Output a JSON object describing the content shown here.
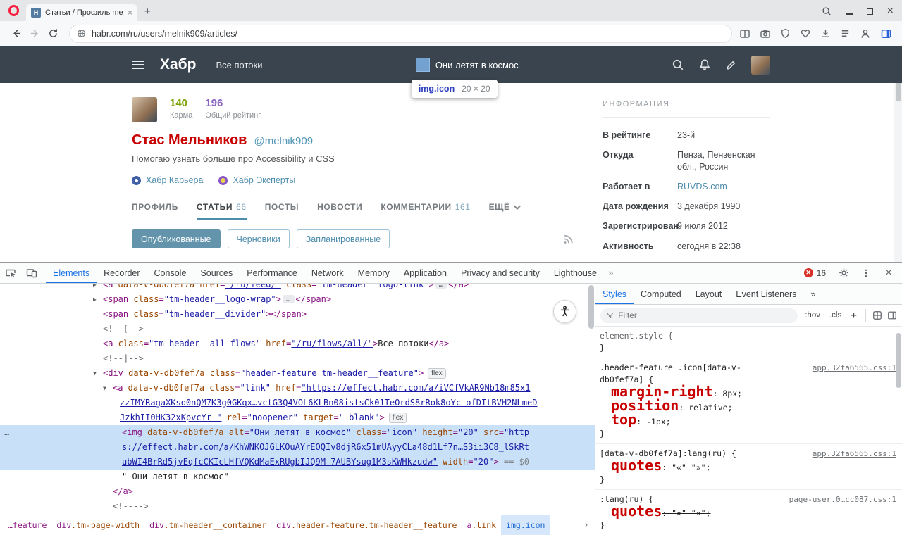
{
  "browser": {
    "tab_title": "Статьи / Профиль melnik...",
    "favicon_letter": "H",
    "tab_close_glyph": "×",
    "new_tab_glyph": "+",
    "window_close_glyph": "×",
    "url": "habr.com/ru/users/melnik909/articles/"
  },
  "site_header": {
    "logo": "Хабр",
    "all_flows": "Все потоки",
    "feature_text": "Они летят в космос",
    "tooltip": {
      "selector": "img.icon",
      "dims": "20 × 20"
    }
  },
  "profile": {
    "karma_value": "140",
    "karma_label": "Карма",
    "rating_value": "196",
    "rating_label": "Общий рейтинг",
    "name": "Стас Мельников",
    "username": "@melnik909",
    "bio": "Помогаю узнать больше про Accessibility и CSS",
    "badges": [
      {
        "label": "Хабр Карьера"
      },
      {
        "label": "Хабр Эксперты"
      }
    ],
    "tabs": [
      {
        "label": "ПРОФИЛЬ"
      },
      {
        "label": "СТАТЬИ",
        "count": "66",
        "active": true
      },
      {
        "label": "ПОСТЫ"
      },
      {
        "label": "НОВОСТИ"
      },
      {
        "label": "КОММЕНТАРИИ",
        "count": "161"
      },
      {
        "label": "ЕЩЁ",
        "chevron": true
      }
    ],
    "filters": [
      {
        "label": "Опубликованные",
        "active": true
      },
      {
        "label": "Черновики"
      },
      {
        "label": "Запланированные"
      }
    ]
  },
  "sidebar_info": {
    "title": "ИНФОРМАЦИЯ",
    "rows": [
      {
        "label": "В рейтинге",
        "value": "23-й"
      },
      {
        "label": "Откуда",
        "value": "Пенза, Пензенская обл., Россия"
      },
      {
        "label": "Работает в",
        "value": "RUVDS.com",
        "link": true
      },
      {
        "label": "Дата рождения",
        "value": "3 декабря 1990"
      },
      {
        "label": "Зарегистрирован",
        "value": "9 июля 2012"
      },
      {
        "label": "Активность",
        "value": "сегодня в 22:38"
      }
    ]
  },
  "devtools": {
    "tabs": [
      "Elements",
      "Recorder",
      "Console",
      "Sources",
      "Performance",
      "Network",
      "Memory",
      "Application",
      "Privacy and security",
      "Lighthouse"
    ],
    "active_tab": "Elements",
    "more_tabs_glyph": "»",
    "error_count": "16",
    "tree": {
      "lines": [
        {
          "pad": 146,
          "arrow": "r",
          "clip": true,
          "tokens": [
            [
              "tag",
              "<a"
            ],
            [
              "attr",
              " data-v-db0fef7a"
            ],
            [
              "attr",
              " href"
            ],
            [
              "p",
              "="
            ],
            [
              "lnk",
              "\"/ru/feed/\""
            ],
            [
              "attr",
              " class"
            ],
            [
              "p",
              "="
            ],
            [
              "val",
              "\"tm-header__logo-link\""
            ],
            [
              "tag",
              ">"
            ],
            [
              "ell",
              "…"
            ],
            [
              "tag",
              "</a>"
            ]
          ]
        },
        {
          "pad": 146,
          "arrow": "r",
          "tokens": [
            [
              "tag",
              "<span"
            ],
            [
              "attr",
              " class"
            ],
            [
              "p",
              "="
            ],
            [
              "val",
              "\"tm-header__logo-wrap\""
            ],
            [
              "tag",
              ">"
            ],
            [
              "ell",
              "…"
            ],
            [
              "tag",
              "</span>"
            ]
          ]
        },
        {
          "pad": 146,
          "tokens": [
            [
              "tag",
              "<span"
            ],
            [
              "attr",
              " class"
            ],
            [
              "p",
              "="
            ],
            [
              "val",
              "\"tm-header__divider\""
            ],
            [
              "tag",
              "></span>"
            ]
          ]
        },
        {
          "pad": 146,
          "tokens": [
            [
              "com",
              "<!--[-->"
            ]
          ]
        },
        {
          "pad": 146,
          "tokens": [
            [
              "tag",
              "<a"
            ],
            [
              "attr",
              " class"
            ],
            [
              "p",
              "="
            ],
            [
              "val",
              "\"tm-header__all-flows\""
            ],
            [
              "attr",
              " href"
            ],
            [
              "p",
              "="
            ],
            [
              "lnk",
              "\"/ru/flows/all/\""
            ],
            [
              "tag",
              ">"
            ],
            [
              "txt",
              "Все потоки"
            ],
            [
              "tag",
              "</a>"
            ]
          ]
        },
        {
          "pad": 146,
          "tokens": [
            [
              "com",
              "<!--]-->"
            ]
          ]
        },
        {
          "pad": 146,
          "arrow": "d",
          "tokens": [
            [
              "tag",
              "<div"
            ],
            [
              "attr",
              " data-v-db0fef7a"
            ],
            [
              "attr",
              " class"
            ],
            [
              "p",
              "="
            ],
            [
              "val",
              "\"header-feature tm-header__feature\""
            ],
            [
              "tag",
              ">"
            ],
            [
              "bdg",
              "flex"
            ]
          ]
        },
        {
          "pad": 160,
          "arrow": "d",
          "tokens": [
            [
              "tag",
              "<a"
            ],
            [
              "attr",
              " data-v-db0fef7a"
            ],
            [
              "attr",
              " class"
            ],
            [
              "p",
              "="
            ],
            [
              "val",
              "\"link\""
            ],
            [
              "attr",
              " href"
            ],
            [
              "p",
              "="
            ],
            [
              "lnk",
              "\"https://effect.habr.com/a/iVCfVkAR9Nb18m85x1"
            ]
          ]
        },
        {
          "pad": 170,
          "tokens": [
            [
              "lnk",
              "zzIMYRagaXKso0nQM7K3g0GKqx…vctG3Q4VOL6KLBn08istsCk01TeOrdS8rRok8oYc-ofDItBVH2NLmeD"
            ]
          ]
        },
        {
          "pad": 170,
          "tokens": [
            [
              "lnk",
              "JzkhII0HK32xKpvcYr_\""
            ],
            [
              "attr",
              " rel"
            ],
            [
              "p",
              "="
            ],
            [
              "val",
              "\"noopener\""
            ],
            [
              "attr",
              " target"
            ],
            [
              "p",
              "="
            ],
            [
              "val",
              "\"_blank\""
            ],
            [
              "tag",
              ">"
            ],
            [
              "bdg",
              "flex"
            ]
          ]
        },
        {
          "pad": 173,
          "sel": true,
          "dots": true,
          "tokens": [
            [
              "tag",
              "<img"
            ],
            [
              "attr",
              " data-v-db0fef7a"
            ],
            [
              "attr",
              " alt"
            ],
            [
              "p",
              "="
            ],
            [
              "val",
              "\"Они летят в космос\""
            ],
            [
              "attr",
              " class"
            ],
            [
              "p",
              "="
            ],
            [
              "val",
              "\"icon\""
            ],
            [
              "attr",
              " height"
            ],
            [
              "p",
              "="
            ],
            [
              "val",
              "\"20\""
            ],
            [
              "attr",
              " src"
            ],
            [
              "p",
              "="
            ],
            [
              "lnk",
              "\"http"
            ]
          ]
        },
        {
          "pad": 173,
          "sel": true,
          "tokens": [
            [
              "lnk",
              "s://effect.habr.com/a/KhWNKOJGLKOuAYrEOQIv8djR6x51mUAyyCLa48d1Lf7n…S3ii3C8_lSkRt"
            ]
          ]
        },
        {
          "pad": 173,
          "sel": true,
          "tokens": [
            [
              "lnk",
              "ubWI4BrRd5jvEqfcCKIcLHfVQKdMaExRUgbIJQ9M-7AUBYsug1M3sKWHkzudw\""
            ],
            [
              "attr",
              " width"
            ],
            [
              "p",
              "="
            ],
            [
              "val",
              "\"20\""
            ],
            [
              "tag",
              ">"
            ],
            [
              "mk",
              " == $0"
            ]
          ]
        },
        {
          "pad": 173,
          "tokens": [
            [
              "txt",
              "\" Они летят в космос\""
            ]
          ]
        },
        {
          "pad": 160,
          "tokens": [
            [
              "tag",
              "</a>"
            ]
          ]
        },
        {
          "pad": 160,
          "tokens": [
            [
              "com",
              "<!---->"
            ]
          ]
        }
      ]
    },
    "styles": {
      "tabs": [
        "Styles",
        "Computed",
        "Layout",
        "Event Listeners"
      ],
      "active_tab": "Styles",
      "more_glyph": "»",
      "filter_placeholder": "Filter",
      "state_button": ":hov",
      "class_button": ".cls",
      "add_button": "+",
      "rules": [
        {
          "gray": true,
          "link": "",
          "selector_lines": [
            "element.style {"
          ],
          "props": [],
          "close": "}"
        },
        {
          "link": "app.32fa6565.css:1",
          "selector_lines": [
            ".header-feature .icon[data-v-",
            "db0fef7a] {"
          ],
          "props": [
            {
              "n": "margin-right",
              "v": "8px"
            },
            {
              "n": "position",
              "v": "relative"
            },
            {
              "n": "top",
              "v": "-1px"
            }
          ],
          "close": "}"
        },
        {
          "link": "app.32fa6565.css:1",
          "selector_lines": [
            "[data-v-db0fef7a]:lang(ru) {"
          ],
          "props": [
            {
              "n": "quotes",
              "v": "\"«\" \"»\""
            }
          ],
          "close": "}"
        },
        {
          "link": "page-user.0…cc087.css:1",
          "selector_lines": [
            ":lang(ru) {"
          ],
          "props": [
            {
              "n": "quotes",
              "v": "\"«\" \"»\"",
              "struck": true
            }
          ],
          "close": "}"
        }
      ]
    },
    "breadcrumbs": [
      {
        "text": "…feature"
      },
      {
        "text": "div.tm-page-width"
      },
      {
        "text": "div.tm-header__container"
      },
      {
        "text": "div.header-feature.tm-header__feature"
      },
      {
        "text": "a.link"
      },
      {
        "text": "img.icon",
        "active": true
      }
    ],
    "crumb_overflow_glyph": "›"
  }
}
